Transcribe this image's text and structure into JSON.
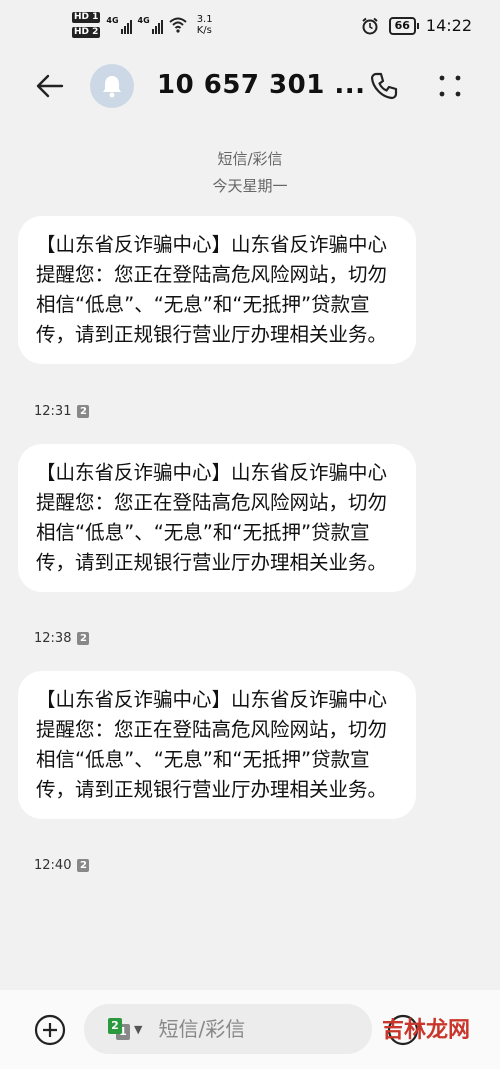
{
  "status_bar": {
    "hd1": "HD 1",
    "hd2": "HD 2",
    "net1": "4G",
    "net2": "4G",
    "speed_value": "3.1",
    "speed_unit": "K/s",
    "battery": "66",
    "time": "14:22"
  },
  "header": {
    "back_icon": "back-arrow-icon",
    "avatar_icon": "bell-icon",
    "title": "10 657 301 ...",
    "call_icon": "phone-icon",
    "more_icon": "more-vertical-icon"
  },
  "thread_meta": {
    "type": "短信/彩信",
    "date": "今天星期一"
  },
  "messages": [
    {
      "text": "【山东省反诈骗中心】山东省反诈骗中心提醒您：您正在登陆高危风险网站，切勿相信“低息”、“无息”和“无抵押”贷款宣传，请到正规银行营业厅办理相关业务。",
      "time": "12:31",
      "sim": "2"
    },
    {
      "text": "【山东省反诈骗中心】山东省反诈骗中心提醒您：您正在登陆高危风险网站，切勿相信“低息”、“无息”和“无抵押”贷款宣传，请到正规银行营业厅办理相关业务。",
      "time": "12:38",
      "sim": "2"
    },
    {
      "text": "【山东省反诈骗中心】山东省反诈骗中心提醒您：您正在登陆高危风险网站，切勿相信“低息”、“无息”和“无抵押”贷款宣传，请到正规银行营业厅办理相关业务。",
      "time": "12:40",
      "sim": "2"
    }
  ],
  "composer": {
    "sim_primary": "2",
    "sim_secondary": "1",
    "placeholder": "短信/彩信",
    "watermark": "吉林龙网"
  },
  "colors": {
    "background": "#f1f1f1",
    "bubble": "#ffffff",
    "sim_green": "#2b9a3e"
  }
}
